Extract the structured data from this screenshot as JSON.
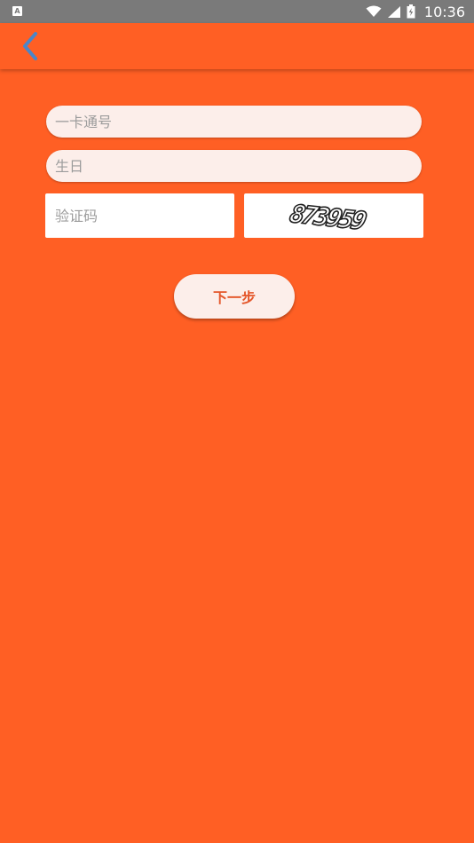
{
  "status_bar": {
    "left_icon_letter": "A",
    "left_icon": "a-notification-icon",
    "wifi_icon": "wifi-icon",
    "signal_icon": "signal-icon",
    "battery_icon": "battery-charging-icon",
    "time": "10:36"
  },
  "app_bar": {
    "back_icon": "chevron-left-icon",
    "back_icon_color": "#4A86C8",
    "background": "#FF5F24"
  },
  "form": {
    "card_number_placeholder": "一卡通号",
    "birthday_placeholder": "生日",
    "captcha_placeholder": "验证码",
    "captcha_image_text": "873959",
    "next_button_label": "下一步"
  },
  "colors": {
    "page_background": "#FF5F24",
    "field_background": "#FCEEEA",
    "button_text": "#E4562A",
    "status_bar": "#7A7A7A"
  }
}
